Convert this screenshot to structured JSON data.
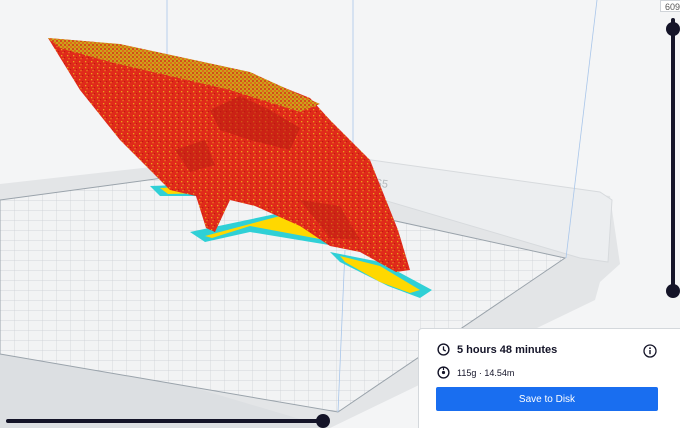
{
  "printer": {
    "watermark_text": "aker S5"
  },
  "layer_slider": {
    "value": "609"
  },
  "print_info": {
    "time": "5 hours 48 minutes",
    "material": "115g · 14.54m",
    "save_button": "Save to Disk"
  },
  "colors": {
    "model": "#e02a1a",
    "model_infill": "#e9a51c",
    "support": "#ffd800",
    "skirt": "#2fd0d6",
    "accent": "#196ef0",
    "slider": "#141428"
  },
  "icons": [
    "clock-icon",
    "spool-icon",
    "info-icon"
  ]
}
